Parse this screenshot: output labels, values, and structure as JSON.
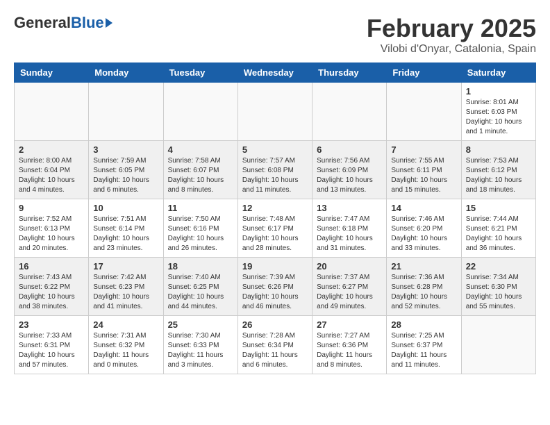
{
  "header": {
    "logo_general": "General",
    "logo_blue": "Blue",
    "month_title": "February 2025",
    "location": "Vilobi d'Onyar, Catalonia, Spain"
  },
  "days_of_week": [
    "Sunday",
    "Monday",
    "Tuesday",
    "Wednesday",
    "Thursday",
    "Friday",
    "Saturday"
  ],
  "weeks": [
    [
      {
        "day": "",
        "info": ""
      },
      {
        "day": "",
        "info": ""
      },
      {
        "day": "",
        "info": ""
      },
      {
        "day": "",
        "info": ""
      },
      {
        "day": "",
        "info": ""
      },
      {
        "day": "",
        "info": ""
      },
      {
        "day": "1",
        "info": "Sunrise: 8:01 AM\nSunset: 6:03 PM\nDaylight: 10 hours\nand 1 minute."
      }
    ],
    [
      {
        "day": "2",
        "info": "Sunrise: 8:00 AM\nSunset: 6:04 PM\nDaylight: 10 hours\nand 4 minutes."
      },
      {
        "day": "3",
        "info": "Sunrise: 7:59 AM\nSunset: 6:05 PM\nDaylight: 10 hours\nand 6 minutes."
      },
      {
        "day": "4",
        "info": "Sunrise: 7:58 AM\nSunset: 6:07 PM\nDaylight: 10 hours\nand 8 minutes."
      },
      {
        "day": "5",
        "info": "Sunrise: 7:57 AM\nSunset: 6:08 PM\nDaylight: 10 hours\nand 11 minutes."
      },
      {
        "day": "6",
        "info": "Sunrise: 7:56 AM\nSunset: 6:09 PM\nDaylight: 10 hours\nand 13 minutes."
      },
      {
        "day": "7",
        "info": "Sunrise: 7:55 AM\nSunset: 6:11 PM\nDaylight: 10 hours\nand 15 minutes."
      },
      {
        "day": "8",
        "info": "Sunrise: 7:53 AM\nSunset: 6:12 PM\nDaylight: 10 hours\nand 18 minutes."
      }
    ],
    [
      {
        "day": "9",
        "info": "Sunrise: 7:52 AM\nSunset: 6:13 PM\nDaylight: 10 hours\nand 20 minutes."
      },
      {
        "day": "10",
        "info": "Sunrise: 7:51 AM\nSunset: 6:14 PM\nDaylight: 10 hours\nand 23 minutes."
      },
      {
        "day": "11",
        "info": "Sunrise: 7:50 AM\nSunset: 6:16 PM\nDaylight: 10 hours\nand 26 minutes."
      },
      {
        "day": "12",
        "info": "Sunrise: 7:48 AM\nSunset: 6:17 PM\nDaylight: 10 hours\nand 28 minutes."
      },
      {
        "day": "13",
        "info": "Sunrise: 7:47 AM\nSunset: 6:18 PM\nDaylight: 10 hours\nand 31 minutes."
      },
      {
        "day": "14",
        "info": "Sunrise: 7:46 AM\nSunset: 6:20 PM\nDaylight: 10 hours\nand 33 minutes."
      },
      {
        "day": "15",
        "info": "Sunrise: 7:44 AM\nSunset: 6:21 PM\nDaylight: 10 hours\nand 36 minutes."
      }
    ],
    [
      {
        "day": "16",
        "info": "Sunrise: 7:43 AM\nSunset: 6:22 PM\nDaylight: 10 hours\nand 38 minutes."
      },
      {
        "day": "17",
        "info": "Sunrise: 7:42 AM\nSunset: 6:23 PM\nDaylight: 10 hours\nand 41 minutes."
      },
      {
        "day": "18",
        "info": "Sunrise: 7:40 AM\nSunset: 6:25 PM\nDaylight: 10 hours\nand 44 minutes."
      },
      {
        "day": "19",
        "info": "Sunrise: 7:39 AM\nSunset: 6:26 PM\nDaylight: 10 hours\nand 46 minutes."
      },
      {
        "day": "20",
        "info": "Sunrise: 7:37 AM\nSunset: 6:27 PM\nDaylight: 10 hours\nand 49 minutes."
      },
      {
        "day": "21",
        "info": "Sunrise: 7:36 AM\nSunset: 6:28 PM\nDaylight: 10 hours\nand 52 minutes."
      },
      {
        "day": "22",
        "info": "Sunrise: 7:34 AM\nSunset: 6:30 PM\nDaylight: 10 hours\nand 55 minutes."
      }
    ],
    [
      {
        "day": "23",
        "info": "Sunrise: 7:33 AM\nSunset: 6:31 PM\nDaylight: 10 hours\nand 57 minutes."
      },
      {
        "day": "24",
        "info": "Sunrise: 7:31 AM\nSunset: 6:32 PM\nDaylight: 11 hours\nand 0 minutes."
      },
      {
        "day": "25",
        "info": "Sunrise: 7:30 AM\nSunset: 6:33 PM\nDaylight: 11 hours\nand 3 minutes."
      },
      {
        "day": "26",
        "info": "Sunrise: 7:28 AM\nSunset: 6:34 PM\nDaylight: 11 hours\nand 6 minutes."
      },
      {
        "day": "27",
        "info": "Sunrise: 7:27 AM\nSunset: 6:36 PM\nDaylight: 11 hours\nand 8 minutes."
      },
      {
        "day": "28",
        "info": "Sunrise: 7:25 AM\nSunset: 6:37 PM\nDaylight: 11 hours\nand 11 minutes."
      },
      {
        "day": "",
        "info": ""
      }
    ]
  ]
}
